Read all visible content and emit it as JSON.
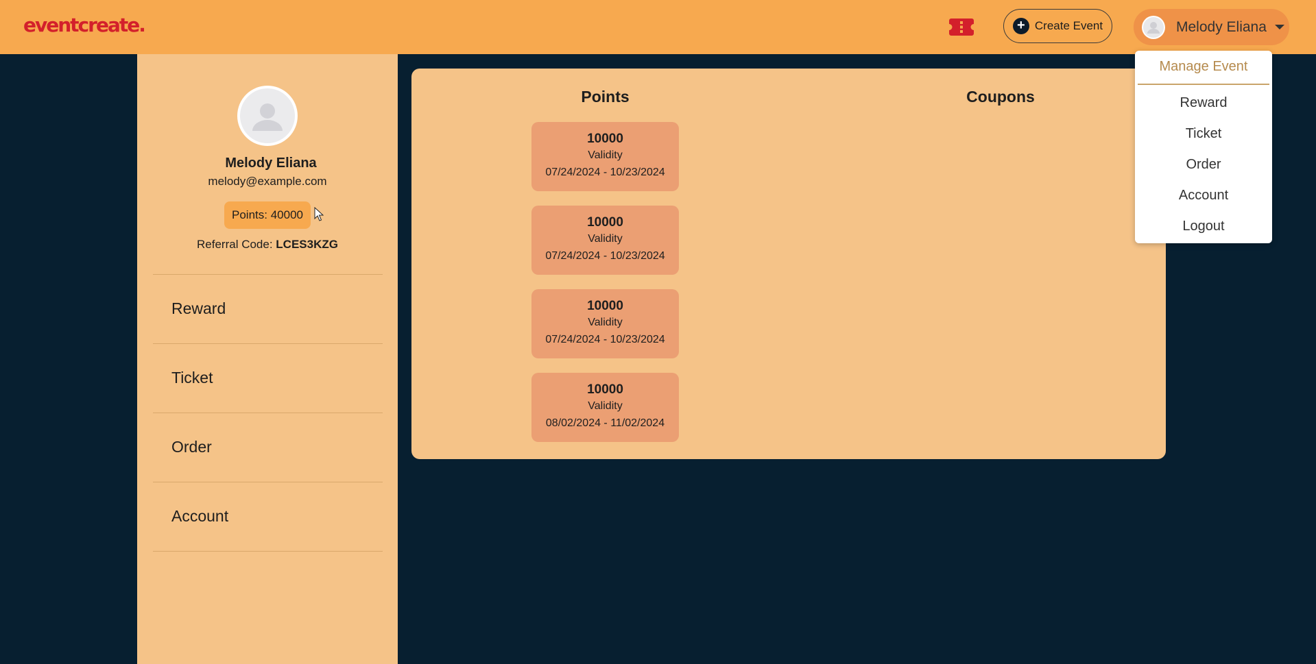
{
  "header": {
    "logo": "eventcreate.",
    "create_event_label": "Create Event",
    "user_name": "Melody Eliana"
  },
  "dropdown": {
    "manage_event": "Manage Event",
    "items": [
      "Reward",
      "Ticket",
      "Order",
      "Account",
      "Logout"
    ]
  },
  "profile": {
    "name": "Melody Eliana",
    "email": "melody@example.com",
    "points_label": "Points: 40000",
    "referral_label": "Referral Code: ",
    "referral_code": "LCES3KZG"
  },
  "sidebar": {
    "items": [
      "Reward",
      "Ticket",
      "Order",
      "Account"
    ]
  },
  "main": {
    "points_title": "Points",
    "coupons_title": "Coupons",
    "points": [
      {
        "amount": "10000",
        "validity_label": "Validity",
        "dates": "07/24/2024 - 10/23/2024"
      },
      {
        "amount": "10000",
        "validity_label": "Validity",
        "dates": "07/24/2024 - 10/23/2024"
      },
      {
        "amount": "10000",
        "validity_label": "Validity",
        "dates": "07/24/2024 - 10/23/2024"
      },
      {
        "amount": "10000",
        "validity_label": "Validity",
        "dates": "08/02/2024 - 11/02/2024"
      }
    ]
  },
  "colors": {
    "header_bg": "#f7a94f",
    "page_bg": "#071f30",
    "panel_bg": "#f5c388",
    "point_card_bg": "#eb9f73",
    "logo": "#d3202b"
  }
}
